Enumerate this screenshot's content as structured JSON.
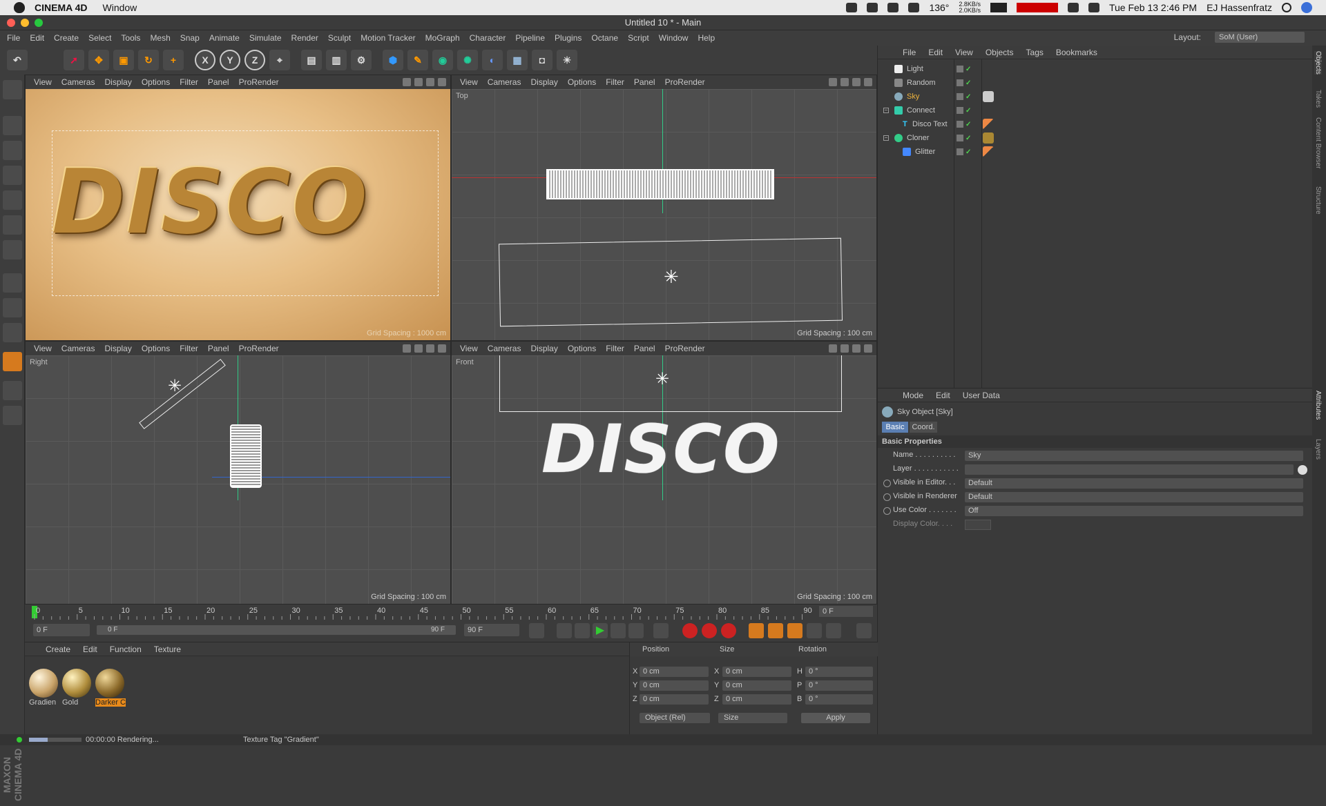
{
  "macbar": {
    "app_name": "CINEMA 4D",
    "menu_window": "Window",
    "temperature": "136°",
    "net_up": "2.8KB/s",
    "net_down": "2.0KB/s",
    "datetime": "Tue Feb 13  2:46 PM",
    "user": "EJ Hassenfratz"
  },
  "window": {
    "title": "Untitled 10 * - Main"
  },
  "menu": [
    "File",
    "Edit",
    "Create",
    "Select",
    "Tools",
    "Mesh",
    "Snap",
    "Animate",
    "Simulate",
    "Render",
    "Sculpt",
    "Motion Tracker",
    "MoGraph",
    "Character",
    "Pipeline",
    "Plugins",
    "Octane",
    "Script",
    "Window",
    "Help"
  ],
  "layout": {
    "label": "Layout:",
    "value": "SoM (User)"
  },
  "toolbar": {
    "x": "X",
    "y": "Y",
    "z": "Z"
  },
  "viewport_menu": [
    "View",
    "Cameras",
    "Display",
    "Options",
    "Filter",
    "Panel",
    "ProRender"
  ],
  "viewports": {
    "perspective": {
      "text": "DISCO",
      "grid": "Grid Spacing : 1000 cm"
    },
    "top": {
      "label": "Top",
      "grid": "Grid Spacing : 100 cm"
    },
    "right": {
      "label": "Right",
      "grid": "Grid Spacing : 100 cm"
    },
    "front": {
      "label": "Front",
      "text": "DISCO",
      "grid": "Grid Spacing : 100 cm"
    }
  },
  "object_manager": {
    "menu": [
      "File",
      "Edit",
      "View",
      "Objects",
      "Tags",
      "Bookmarks"
    ],
    "objects": [
      {
        "name": "Light",
        "color": "#d0d0d0"
      },
      {
        "name": "Random",
        "color": "#d0d0d0"
      },
      {
        "name": "Sky",
        "color": "#f0b43c"
      },
      {
        "name": "Connect",
        "color": "#d0d0d0"
      },
      {
        "name": "Disco Text",
        "color": "#d0d0d0"
      },
      {
        "name": "Cloner",
        "color": "#d0d0d0"
      },
      {
        "name": "Glitter",
        "color": "#d0d0d0"
      }
    ]
  },
  "attribute_manager": {
    "menu": [
      "Mode",
      "Edit",
      "User Data"
    ],
    "object_title": "Sky Object [Sky]",
    "tabs": [
      "Basic",
      "Coord."
    ],
    "section": "Basic Properties",
    "fields": {
      "name_label": "Name . . . . . . . . . .",
      "name_value": "Sky",
      "layer_label": "Layer . . . . . . . . . . .",
      "layer_value": "",
      "vis_editor_label": "Visible in Editor. . .",
      "vis_editor_value": "Default",
      "vis_render_label": "Visible in Renderer",
      "vis_render_value": "Default",
      "use_color_label": "Use Color . . . . . . .",
      "use_color_value": "Off",
      "display_color_label": "Display Color. . . ."
    }
  },
  "sidetabs": [
    "Objects",
    "Takes",
    "Content Browser",
    "Structure",
    "Attributes",
    "Layers"
  ],
  "timeline": {
    "ticks": [
      "0",
      "5",
      "10",
      "15",
      "20",
      "25",
      "30",
      "35",
      "40",
      "45",
      "50",
      "55",
      "60",
      "65",
      "70",
      "75",
      "80",
      "85",
      "90"
    ],
    "current_frame": "0 F",
    "start": "0 F",
    "slider_start": "0 F",
    "slider_end": "90 F",
    "end": "90 F",
    "max": "90 F"
  },
  "material_manager": {
    "menu": [
      "Create",
      "Edit",
      "Function",
      "Texture"
    ],
    "materials": [
      {
        "name": "Gradien",
        "color": "#c9a46a"
      },
      {
        "name": "Gold",
        "color": "#b08d3c"
      },
      {
        "name": "Darker C",
        "color": "#8c6a2a"
      }
    ]
  },
  "coordinates": {
    "headers": [
      "Position",
      "Size",
      "Rotation"
    ],
    "rows": [
      {
        "axis": "X",
        "pos": "0 cm",
        "size_axis": "X",
        "size": "0 cm",
        "rot_axis": "H",
        "rot": "0 °"
      },
      {
        "axis": "Y",
        "pos": "0 cm",
        "size_axis": "Y",
        "size": "0 cm",
        "rot_axis": "P",
        "rot": "0 °"
      },
      {
        "axis": "Z",
        "pos": "0 cm",
        "size_axis": "Z",
        "size": "0 cm",
        "rot_axis": "B",
        "rot": "0 °"
      }
    ],
    "mode_select": "Object (Rel)",
    "size_select": "Size",
    "apply": "Apply"
  },
  "status": {
    "progress": 0.35,
    "render_time": "00:00:00 Rendering...",
    "message": "Texture Tag \"Gradient\""
  }
}
